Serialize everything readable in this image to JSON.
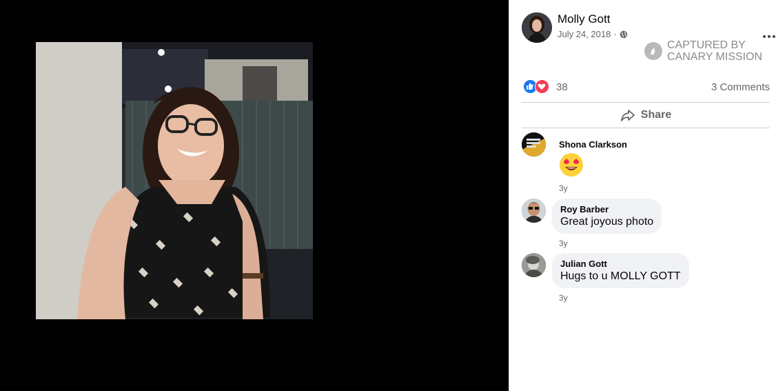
{
  "post": {
    "author": "Molly Gott",
    "date": "July 24, 2018",
    "date_separator": "·",
    "privacy_icon": "globe-icon",
    "more_icon": "more-options-icon"
  },
  "watermark": {
    "line1": "CAPTURED BY",
    "line2": "CANARY MISSION"
  },
  "reactions": {
    "icons": [
      "like-icon",
      "love-icon"
    ],
    "count": "38",
    "comments_label": "3 Comments"
  },
  "actions": {
    "share_label": "Share"
  },
  "comments": [
    {
      "name": "Shona Clarkson",
      "text": "",
      "emoji": "heart-eyes-emoji",
      "time": "3y"
    },
    {
      "name": "Roy Barber",
      "text": "Great joyous photo",
      "time": "3y"
    },
    {
      "name": "Julian Gott",
      "text": "Hugs to u MOLLY GOTT",
      "time": "3y"
    }
  ],
  "colors": {
    "facebook_blue": "#1877f2",
    "love_red": "#f33e58",
    "bubble_gray": "#f0f2f5",
    "meta_gray": "#65676b"
  }
}
